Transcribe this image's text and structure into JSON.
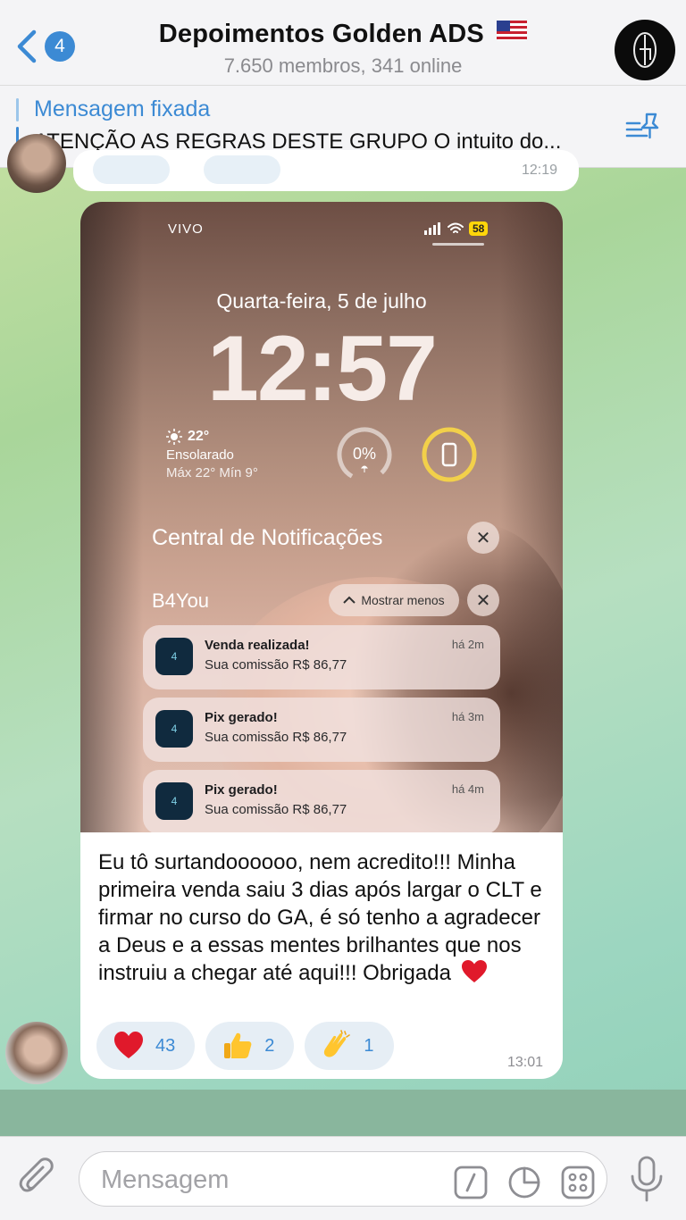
{
  "header": {
    "unread_count": "4",
    "title": "Depoimentos Golden ADS",
    "subtitle": "7.650 membros, 341 online"
  },
  "pinned": {
    "title": "Mensagem fixada",
    "text": "ATENÇÃO AS REGRAS DESTE GRUPO O intuito do..."
  },
  "previous_message": {
    "time": "12:19"
  },
  "message": {
    "screenshot": {
      "carrier": "VIVO",
      "battery": "58",
      "date": "Quarta-feira, 5 de julho",
      "time": "12:57",
      "weather": {
        "temp": "22°",
        "condition": "Ensolarado",
        "range": "Máx 22° Mín 9°"
      },
      "rain_chance": "0%",
      "notification_center": "Central de Notificações",
      "app_name": "B4You",
      "show_less": "Mostrar menos",
      "notifications": [
        {
          "title": "Venda realizada!",
          "body": "Sua comissão R$ 86,77",
          "time": "há 2m"
        },
        {
          "title": "Pix gerado!",
          "body": "Sua comissão R$ 86,77",
          "time": "há 3m"
        },
        {
          "title": "Pix gerado!",
          "body": "Sua comissão R$ 86,77",
          "time": "há 4m"
        }
      ]
    },
    "text": "Eu tô surtandoooooo, nem acredito!!! Minha primeira venda saiu 3 dias após largar o CLT e firmar no curso do GA, é só tenho a agradecer a Deus e a essas mentes brilhantes que nos instruiu a chegar até aqui!!! Obrigada",
    "reactions": [
      {
        "emoji": "heart-icon",
        "count": "43"
      },
      {
        "emoji": "thumbs-up-icon",
        "count": "2"
      },
      {
        "emoji": "clapping-hands-icon",
        "count": "1"
      }
    ],
    "time": "13:01"
  },
  "composer": {
    "placeholder": "Mensagem"
  },
  "colors": {
    "accent": "#3c8ad4",
    "bubble": "#ffffff",
    "header_bg": "#f4f4f6"
  }
}
